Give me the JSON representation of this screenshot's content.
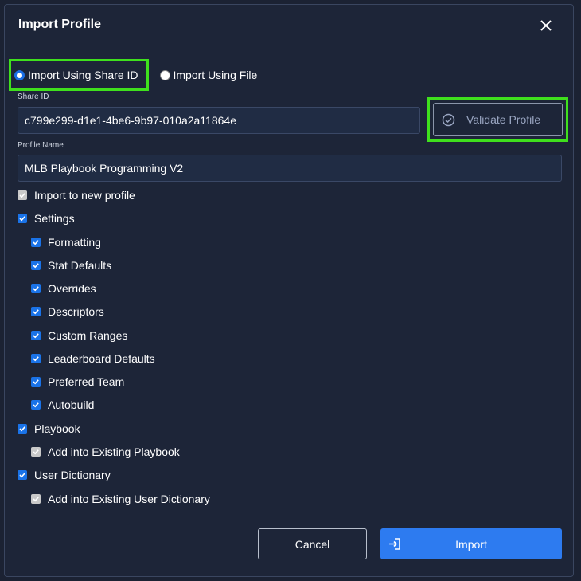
{
  "dialog": {
    "title": "Import Profile"
  },
  "import_mode": {
    "options": [
      {
        "label": "Import Using Share ID",
        "selected": true
      },
      {
        "label": "Import Using File",
        "selected": false
      }
    ]
  },
  "share_id": {
    "label": "Share ID",
    "value": "c799e299-d1e1-4be6-9b97-010a2a11864e"
  },
  "validate": {
    "label": "Validate Profile"
  },
  "profile_name": {
    "label": "Profile Name",
    "value": "MLB Playbook Programming V2"
  },
  "options": {
    "import_new": {
      "label": "Import to new profile",
      "checked": true,
      "disabled": true
    },
    "settings": {
      "label": "Settings",
      "checked": true
    },
    "settings_items": [
      {
        "label": "Formatting",
        "checked": true
      },
      {
        "label": "Stat Defaults",
        "checked": true
      },
      {
        "label": "Overrides",
        "checked": true
      },
      {
        "label": "Descriptors",
        "checked": true
      },
      {
        "label": "Custom Ranges",
        "checked": true
      },
      {
        "label": "Leaderboard Defaults",
        "checked": true
      },
      {
        "label": "Preferred Team",
        "checked": true
      },
      {
        "label": "Autobuild",
        "checked": true
      }
    ],
    "playbook": {
      "label": "Playbook",
      "checked": true
    },
    "playbook_existing": {
      "label": "Add into Existing Playbook",
      "checked": true,
      "disabled": true
    },
    "dictionary": {
      "label": "User Dictionary",
      "checked": true
    },
    "dictionary_existing": {
      "label": "Add into Existing User Dictionary",
      "checked": true,
      "disabled": true
    }
  },
  "buttons": {
    "cancel": "Cancel",
    "import": "Import"
  },
  "colors": {
    "highlight": "#3fe01d",
    "primary": "#2d7bf0",
    "background": "#1d2538"
  }
}
